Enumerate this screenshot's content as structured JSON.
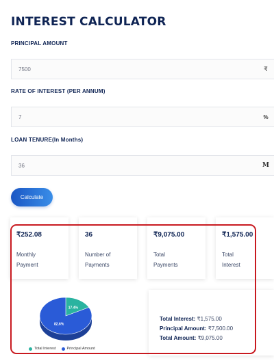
{
  "title": "INTEREST CALCULATOR",
  "principal": {
    "label": "PRINCIPAL AMOUNT",
    "value": "7500",
    "suffix": "₹"
  },
  "rate": {
    "label": "RATE OF INTEREST (PER ANNUM)",
    "value": "7",
    "suffix": "%"
  },
  "tenure": {
    "label": "LOAN TENURE(In Months)",
    "value": "36",
    "suffix": "M"
  },
  "calculate_label": "Calculate",
  "cards": [
    {
      "value": "₹252.08",
      "line1": "Monthly",
      "line2": "Payment"
    },
    {
      "value": "36",
      "line1": "Number of",
      "line2": "Payments"
    },
    {
      "value": "₹9,075.00",
      "line1": "Total",
      "line2": "Payments"
    },
    {
      "value": "₹1,575.00",
      "line1": "Total",
      "line2": "Interest"
    }
  ],
  "summary": {
    "interest_label": "Total Interest:",
    "interest_value": "₹1,575.00",
    "principal_label": "Principal Amount:",
    "principal_value": "₹7,500.00",
    "amount_label": "Total Amount:",
    "amount_value": "₹9,075.00"
  },
  "chart_data": {
    "type": "pie",
    "slices": [
      {
        "name": "Total Interest",
        "value": 17.4,
        "label": "17.4%",
        "color": "#2ab3a0"
      },
      {
        "name": "Principal Amount",
        "value": 82.6,
        "label": "82.6%",
        "color": "#2a5bd7"
      }
    ]
  },
  "colors": {
    "primary": "#0f2454",
    "button": "#2a6fdb",
    "highlight": "#c8191f"
  }
}
